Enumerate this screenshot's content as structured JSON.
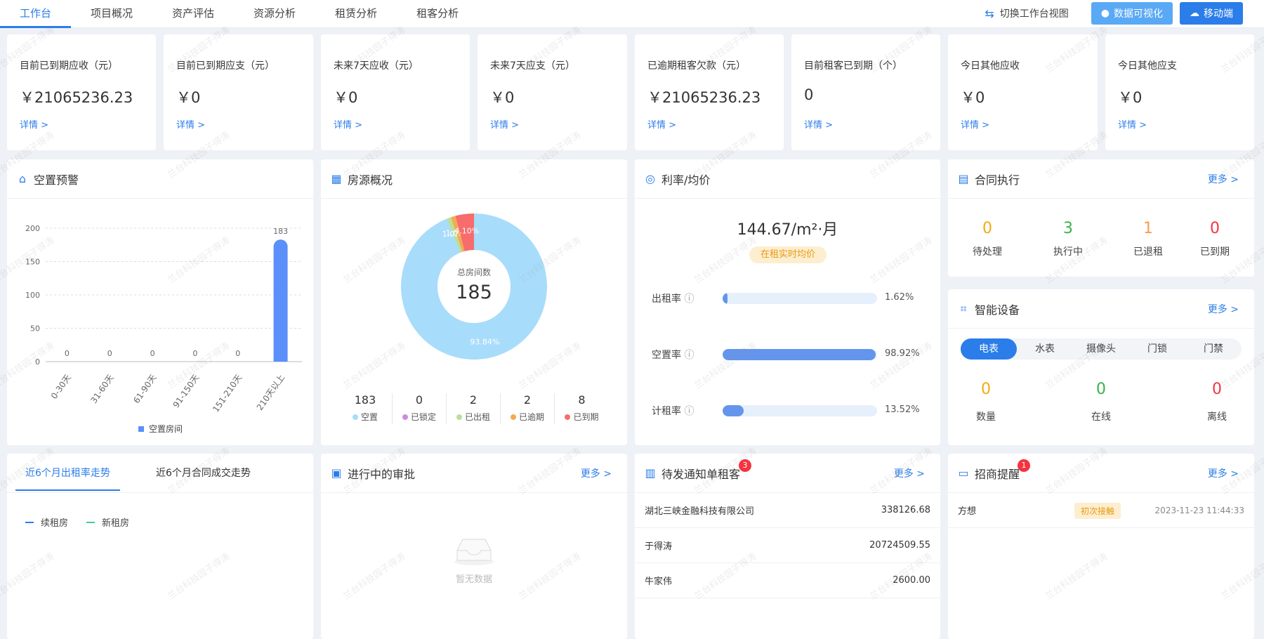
{
  "nav": {
    "tabs": [
      "工作台",
      "项目概况",
      "资产评估",
      "资源分析",
      "租赁分析",
      "租客分析"
    ],
    "switch_label": "切换工作台视图",
    "btn_dataviz": "数据可视化",
    "btn_mobile": "移动端"
  },
  "stats": [
    {
      "label": "目前已到期应收（元）",
      "value": "￥21065236.23",
      "link": "详情 >"
    },
    {
      "label": "目前已到期应支（元）",
      "value": "￥0",
      "link": "详情 >"
    },
    {
      "label": "未来7天应收（元）",
      "value": "￥0",
      "link": "详情 >"
    },
    {
      "label": "未来7天应支（元）",
      "value": "￥0",
      "link": "详情 >"
    },
    {
      "label": "已逾期租客欠款（元）",
      "value": "￥21065236.23",
      "link": "详情 >"
    },
    {
      "label": "目前租客已到期（个）",
      "value": "0",
      "link": "详情 >"
    },
    {
      "label": "今日其他应收",
      "value": "￥0",
      "link": "详情 >"
    },
    {
      "label": "今日其他应支",
      "value": "￥0",
      "link": "详情 >"
    }
  ],
  "vacancy": {
    "title": "空置预警",
    "legend": "空置房间"
  },
  "chart_data": [
    {
      "type": "bar",
      "title": "空置预警",
      "categories": [
        "0-30天",
        "31-60天",
        "61-90天",
        "91-150天",
        "151-210天",
        "210天以上"
      ],
      "series": [
        {
          "name": "空置房间",
          "values": [
            0,
            0,
            0,
            0,
            0,
            183
          ]
        }
      ],
      "ylim": [
        0,
        200
      ],
      "yticks": [
        0,
        50,
        100,
        150,
        200
      ],
      "grid": true,
      "legend_position": "bottom",
      "color": "#5b8ff9"
    },
    {
      "type": "pie",
      "title": "房源概况",
      "center_label": "总房间数",
      "center_value": "185",
      "categories": [
        "空置",
        "已锁定",
        "已出租",
        "已逾期",
        "已到期"
      ],
      "values": [
        183,
        0,
        2,
        2,
        8
      ],
      "slice_labels": [
        "93.84%",
        "",
        "1.03%",
        "1.03%",
        "4.10%"
      ],
      "colors": [
        "#a8dcfb",
        "#c98be6",
        "#b8dfa0",
        "#f5a94f",
        "#f76c6c"
      ]
    }
  ],
  "housing": {
    "title": "房源概况",
    "center_label": "总房间数",
    "center_value": "185",
    "stats": [
      {
        "num": "183",
        "label": "空置",
        "color": "#a8dcfb"
      },
      {
        "num": "0",
        "label": "已锁定",
        "color": "#c98be6"
      },
      {
        "num": "2",
        "label": "已出租",
        "color": "#b8dfa0"
      },
      {
        "num": "2",
        "label": "已逾期",
        "color": "#f5a94f"
      },
      {
        "num": "8",
        "label": "已到期",
        "color": "#f76c6c"
      }
    ]
  },
  "rate": {
    "title": "利率/均价",
    "price": "144.67/m²·月",
    "price_tag": "在租实时均价",
    "rows": [
      {
        "label": "出租率",
        "pct": "1.62%",
        "fraction": 0.0162
      },
      {
        "label": "空置率",
        "pct": "98.92%",
        "fraction": 0.9892
      },
      {
        "label": "计租率",
        "pct": "13.52%",
        "fraction": 0.1352
      }
    ]
  },
  "contract": {
    "title": "合同执行",
    "more": "更多 >",
    "items": [
      {
        "num": "0",
        "label": "待处理",
        "color": "#f0ab0f"
      },
      {
        "num": "3",
        "label": "执行中",
        "color": "#3bb346"
      },
      {
        "num": "1",
        "label": "已退租",
        "color": "#f79d52"
      },
      {
        "num": "0",
        "label": "已到期",
        "color": "#f5333f"
      }
    ]
  },
  "devices": {
    "title": "智能设备",
    "more": "更多 >",
    "tabs": [
      "电表",
      "水表",
      "摄像头",
      "门锁",
      "门禁"
    ],
    "items": [
      {
        "num": "0",
        "label": "数量",
        "color": "#f0ab0f"
      },
      {
        "num": "0",
        "label": "在线",
        "color": "#3bb346"
      },
      {
        "num": "0",
        "label": "离线",
        "color": "#f5333f"
      }
    ]
  },
  "trend": {
    "tabs": [
      "近6个月出租率走势",
      "近6个月合同成交走势"
    ],
    "legend": [
      {
        "label": "续租房",
        "color": "#2b7de9"
      },
      {
        "label": "新租房",
        "color": "#3ccf9b"
      }
    ]
  },
  "approval": {
    "title": "进行中的审批",
    "more": "更多 >",
    "empty": "暂无数据"
  },
  "notice": {
    "title": "待发通知单租客",
    "badge": "3",
    "more": "更多 >",
    "rows": [
      {
        "name": "湖北三峡金融科技有限公司",
        "amount": "338126.68"
      },
      {
        "name": "于得涛",
        "amount": "20724509.55"
      },
      {
        "name": "牛家伟",
        "amount": "2600.00"
      }
    ]
  },
  "leads": {
    "title": "招商提醒",
    "badge": "1",
    "more": "更多 >",
    "rows": [
      {
        "name": "方想",
        "tag": "初次接触",
        "time": "2023-11-23 11:44:33"
      }
    ]
  },
  "watermark": "兰台科技园子得涛"
}
